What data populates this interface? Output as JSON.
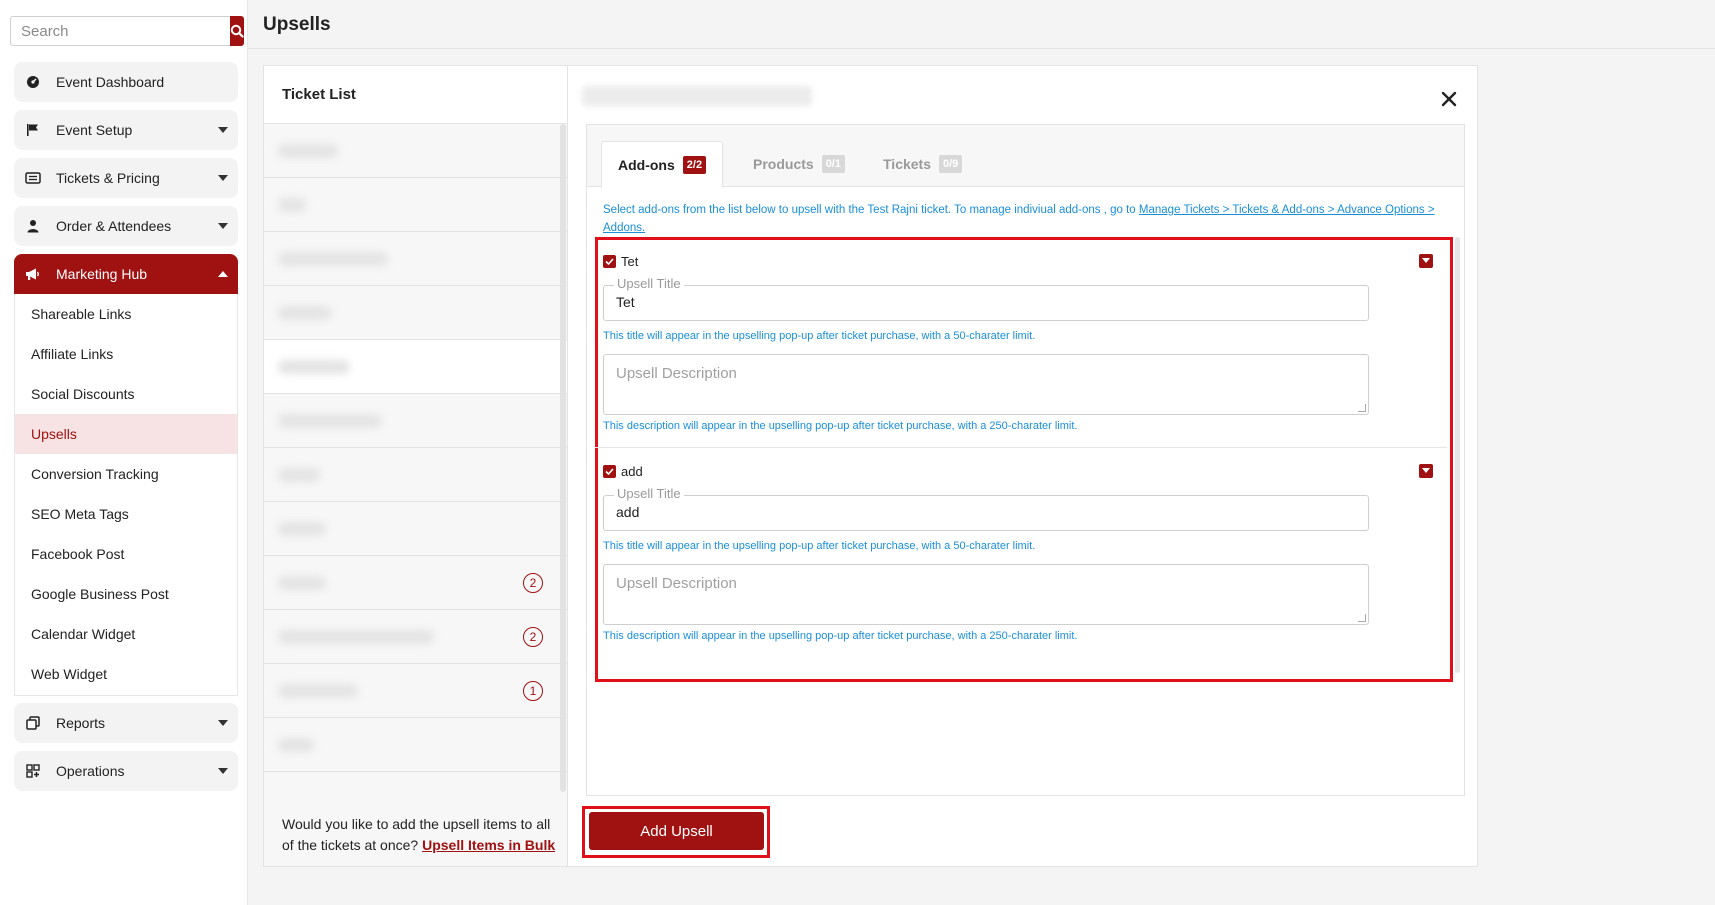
{
  "search": {
    "placeholder": "Search"
  },
  "page": {
    "title": "Upsells"
  },
  "sidebar": {
    "top_items": [
      {
        "label": "Event Dashboard"
      },
      {
        "label": "Event Setup"
      },
      {
        "label": "Tickets & Pricing"
      },
      {
        "label": "Order & Attendees"
      },
      {
        "label": "Marketing Hub"
      }
    ],
    "sub_items": [
      {
        "label": "Shareable Links"
      },
      {
        "label": "Affiliate Links"
      },
      {
        "label": "Social Discounts"
      },
      {
        "label": "Upsells"
      },
      {
        "label": "Conversion Tracking"
      },
      {
        "label": "SEO Meta Tags"
      },
      {
        "label": "Facebook Post"
      },
      {
        "label": "Google Business Post"
      },
      {
        "label": "Calendar Widget"
      },
      {
        "label": "Web Widget"
      }
    ],
    "bottom_items": [
      {
        "label": "Reports"
      },
      {
        "label": "Operations"
      }
    ]
  },
  "ticket_list": {
    "title": "Ticket List",
    "badges": [
      "2",
      "2",
      "1"
    ],
    "bulk_prompt": "Would you like to add the upsell items to all of the tickets at once?",
    "bulk_link": "Upsell Items in Bulk"
  },
  "tabs": [
    {
      "label": "Add-ons",
      "badge": "2/2"
    },
    {
      "label": "Products",
      "badge": "0/1"
    },
    {
      "label": "Tickets",
      "badge": "0/9"
    }
  ],
  "info": {
    "text": "Select add-ons from the list below to upsell with the Test Rajni ticket. To manage indiviual add-ons , go to",
    "link": "Manage Tickets > Tickets & Add-ons > Advance Options > Addons."
  },
  "addons": [
    {
      "name": "Tet",
      "title_legend": "Upsell Title",
      "title_value": "Tet",
      "title_hint": "This title will appear in the upselling pop-up after ticket purchase, with a 50-charater limit.",
      "desc_placeholder": "Upsell Description",
      "desc_hint": "This description will appear in the upselling pop-up after ticket purchase, with a 250-charater limit."
    },
    {
      "name": "add",
      "title_legend": "Upsell Title",
      "title_value": "add",
      "title_hint": "This title will appear in the upselling pop-up after ticket purchase, with a 50-charater limit.",
      "desc_placeholder": "Upsell Description",
      "desc_hint": "This description will appear in the upselling pop-up after ticket purchase, with a 250-charater limit."
    }
  ],
  "actions": {
    "add_upsell": "Add Upsell"
  },
  "colors": {
    "brand": "#a01212",
    "highlight": "#e10f1a",
    "info": "#1a8fd8"
  }
}
